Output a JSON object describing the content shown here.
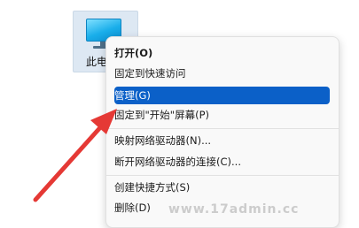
{
  "desktop_icon": {
    "label": "此电脑"
  },
  "context_menu": {
    "items": [
      {
        "label": "打开(O)"
      },
      {
        "label": "固定到快速访问"
      },
      {
        "label": "管理(G)"
      },
      {
        "label": "固定到\"开始\"屏幕(P)"
      },
      {
        "label": "映射网络驱动器(N)..."
      },
      {
        "label": "断开网络驱动器的连接(C)..."
      },
      {
        "label": "创建快捷方式(S)"
      },
      {
        "label": "删除(D)"
      }
    ]
  },
  "watermark": "www.17admin.cc",
  "colors": {
    "selection": "#0b60c8",
    "arrow": "#e53935"
  }
}
